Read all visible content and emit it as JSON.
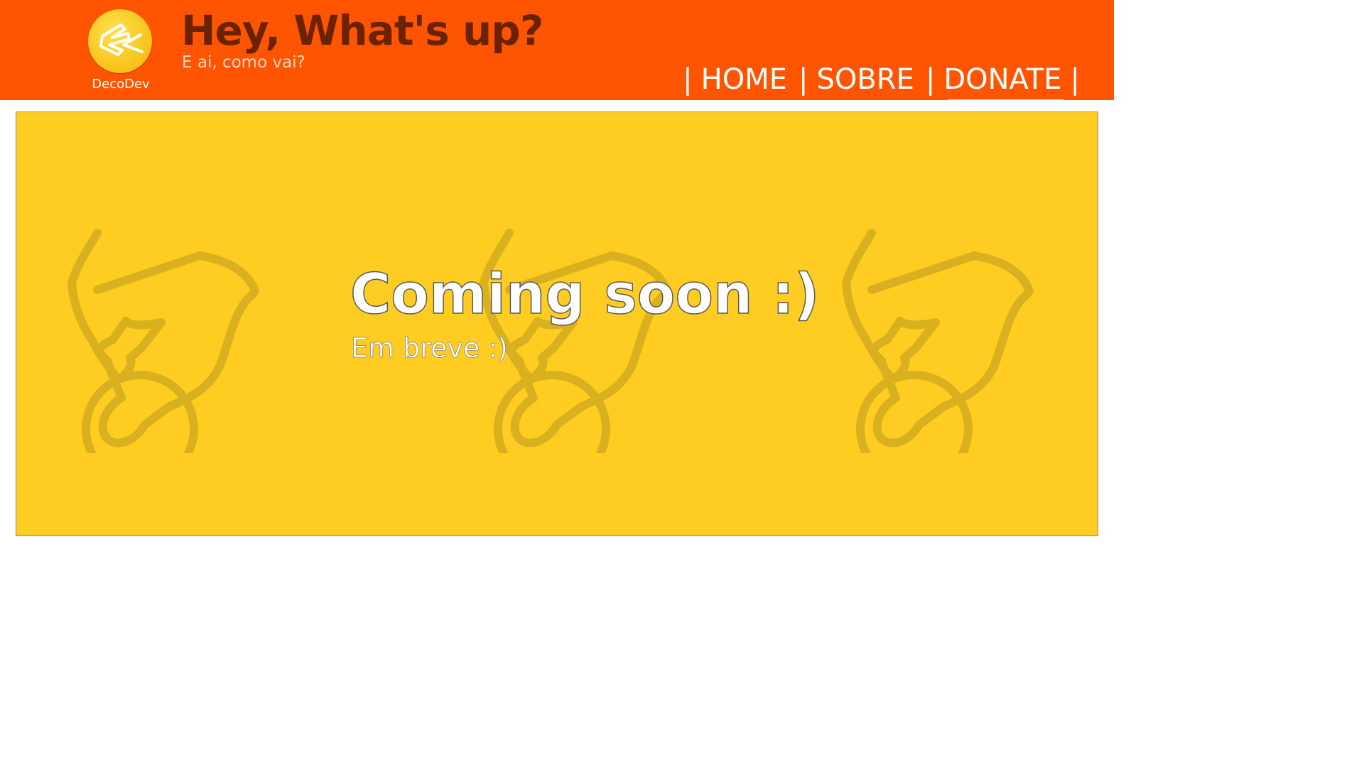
{
  "brand": {
    "logo_name": "DecoDev"
  },
  "header": {
    "title": "Hey, What's up?",
    "subtitle": "E ai, como vai?"
  },
  "nav": {
    "separator": "|",
    "items": [
      {
        "label": "HOME"
      },
      {
        "label": "SOBRE"
      },
      {
        "label": "DONATE"
      }
    ],
    "active": "DONATE"
  },
  "banner": {
    "title": "Coming soon :)",
    "subtitle": "Em breve :)"
  },
  "colors": {
    "header_bg": "#ff5500",
    "title_color": "#6b2200",
    "banner_bg": "#ffcd22",
    "watermark": "#d9b01e"
  },
  "icons": {
    "logo": "decodev-logo-icon",
    "watermark": "hand-with-ring-icon"
  }
}
